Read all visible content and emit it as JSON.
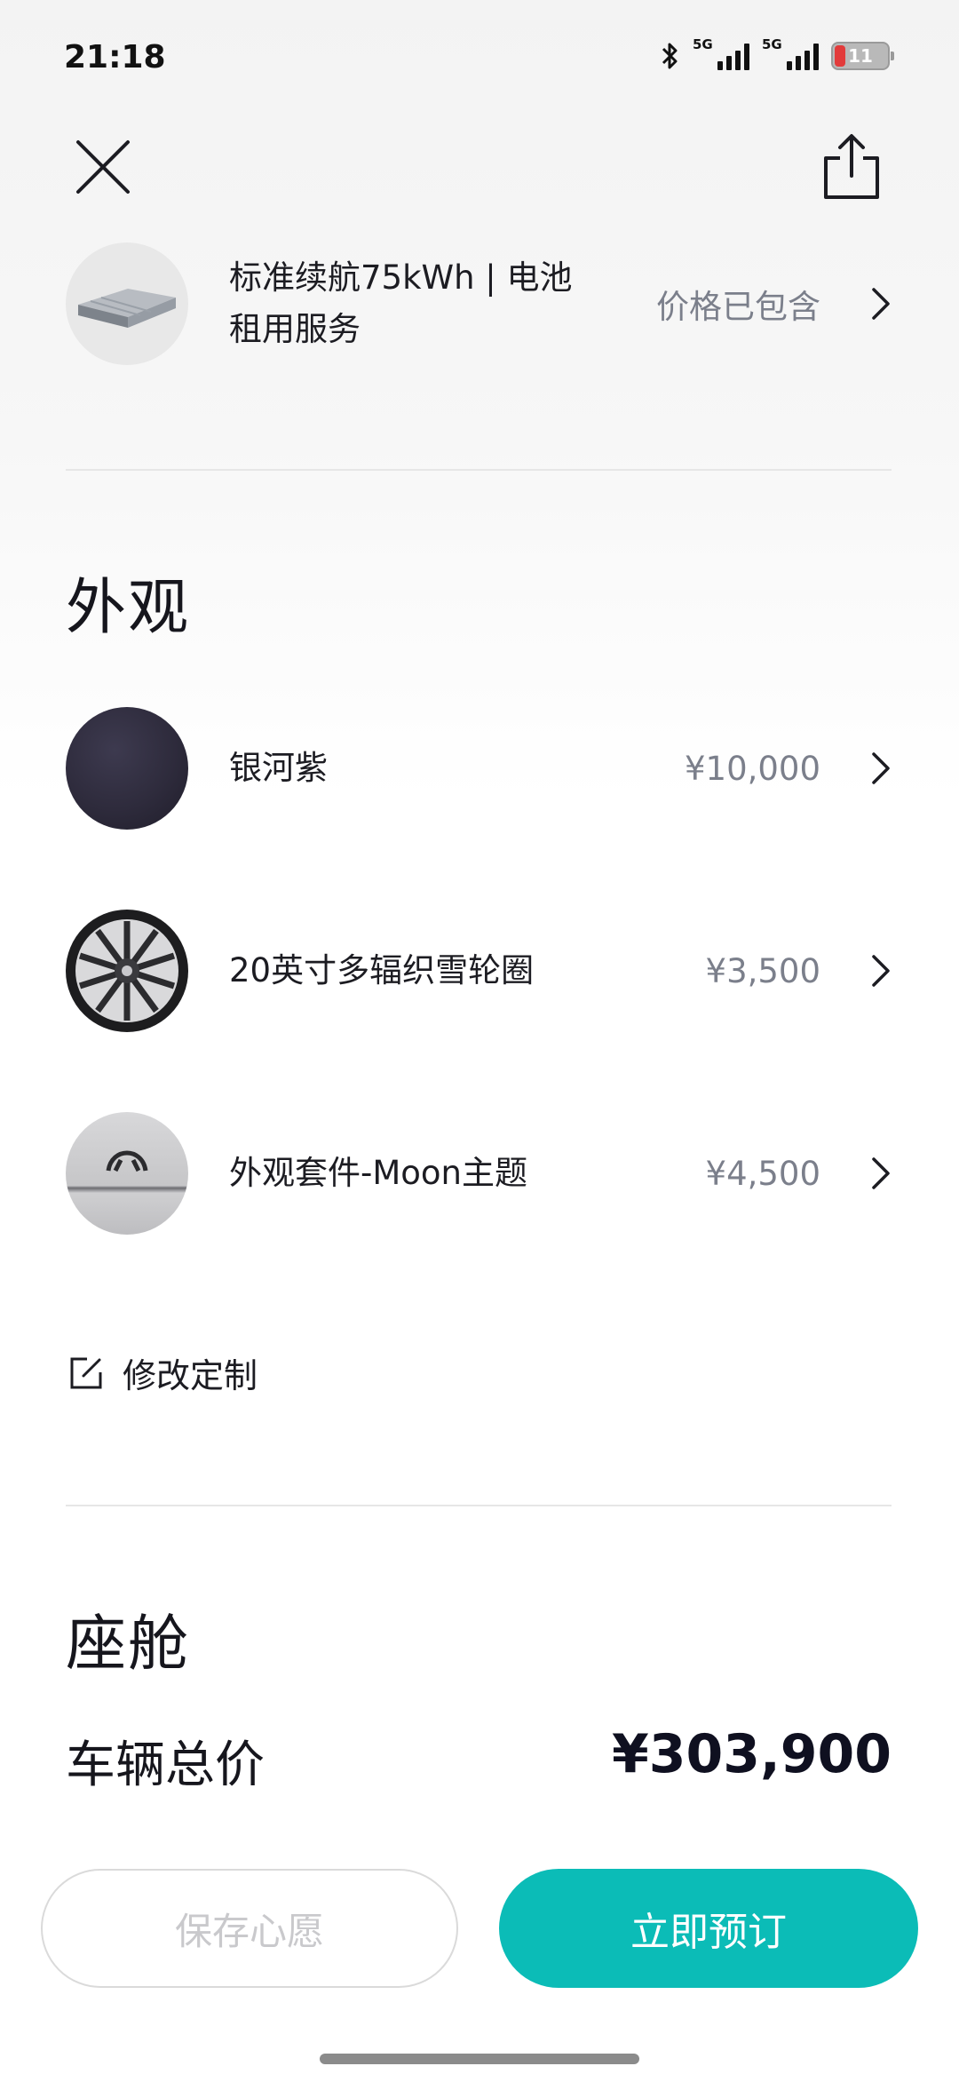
{
  "status_bar": {
    "time": "21:18",
    "network_1": "5G",
    "network_2": "5G",
    "battery": "11"
  },
  "battery_service": {
    "label": "标准续航75kWh | 电池租用服务",
    "value": "价格已包含"
  },
  "exterior": {
    "title": "外观",
    "options": [
      {
        "label": "银河紫",
        "price": "¥10,000",
        "icon": "paint-color-swatch"
      },
      {
        "label": "20英寸多辐织雪轮圈",
        "price": "¥3,500",
        "icon": "wheel-rim"
      },
      {
        "label": "外观套件-Moon主题",
        "price": "¥4,500",
        "icon": "exterior-kit"
      }
    ],
    "modify_label": "修改定制"
  },
  "cabin": {
    "title": "座舱"
  },
  "total": {
    "label": "车辆总价",
    "value": "¥303,900"
  },
  "actions": {
    "save_label": "保存心愿",
    "book_label": "立即预订"
  },
  "colors": {
    "accent": "#0bbcb7",
    "swatch_purple": "#2e2b3c",
    "battery_low": "#e23b3b"
  }
}
